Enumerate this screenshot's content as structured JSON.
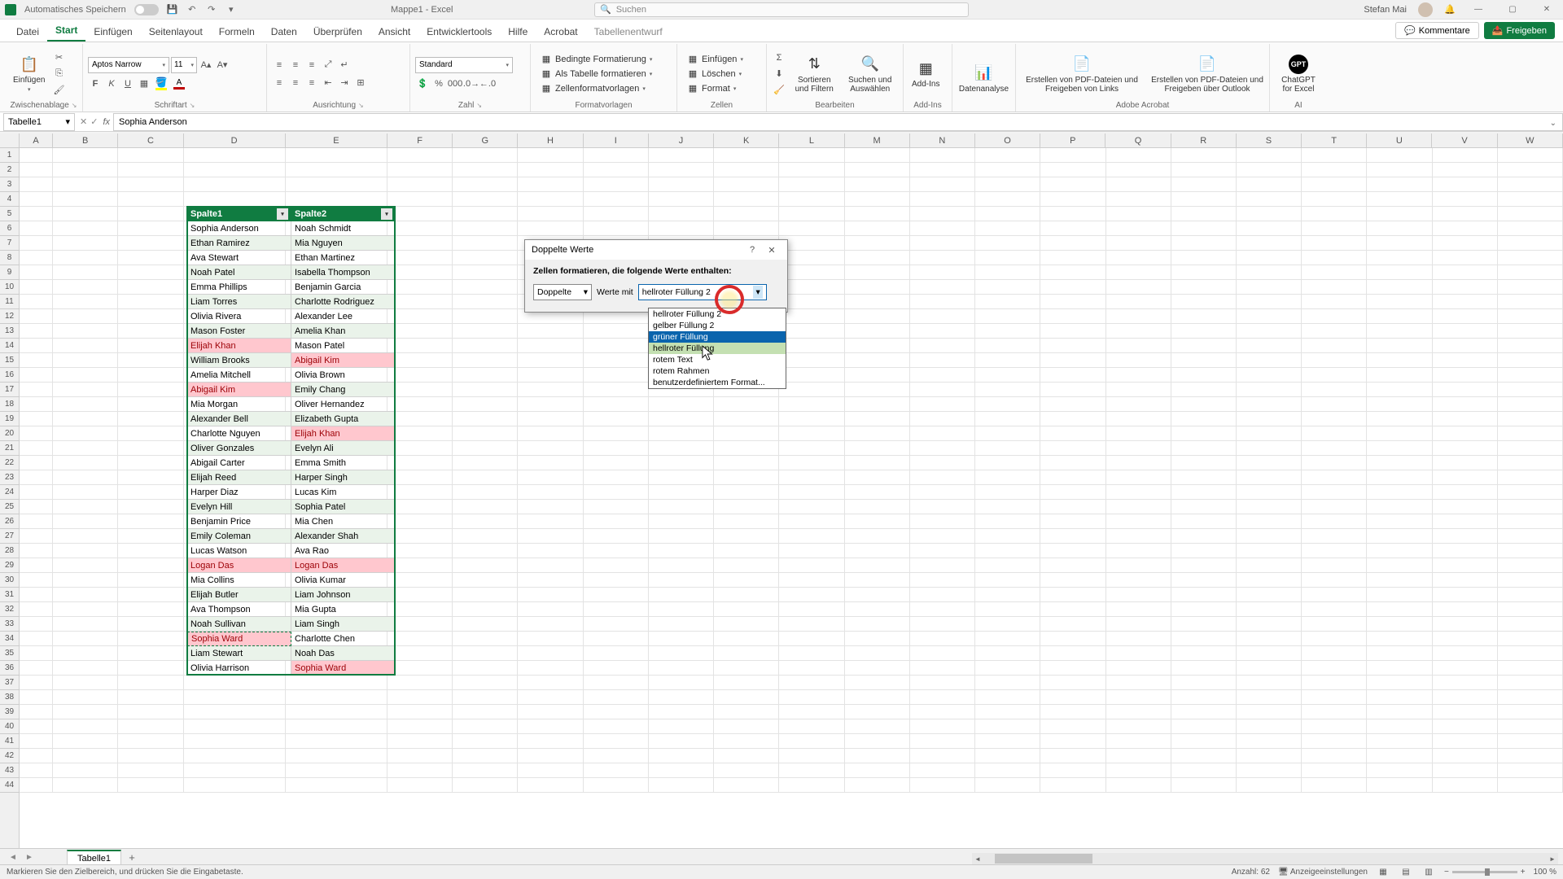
{
  "titlebar": {
    "autosave": "Automatisches Speichern",
    "doc": "Mappe1 - Excel",
    "search_placeholder": "Suchen",
    "user": "Stefan Mai"
  },
  "tabs": {
    "datei": "Datei",
    "start": "Start",
    "einfuegen": "Einfügen",
    "seitenlayout": "Seitenlayout",
    "formeln": "Formeln",
    "daten": "Daten",
    "ueberpruefen": "Überprüfen",
    "ansicht": "Ansicht",
    "entwicklertools": "Entwicklertools",
    "hilfe": "Hilfe",
    "acrobat": "Acrobat",
    "tabellenentwurf": "Tabellenentwurf",
    "kommentare": "Kommentare",
    "freigeben": "Freigeben"
  },
  "ribbon": {
    "zwischenablage": "Zwischenablage",
    "einfuegen": "Einfügen",
    "schriftart": "Schriftart",
    "font_name": "Aptos Narrow",
    "font_size": "11",
    "ausrichtung": "Ausrichtung",
    "zahl": "Zahl",
    "number_format": "Standard",
    "formatvorlagen": "Formatvorlagen",
    "bedingte": "Bedingte Formatierung",
    "als_tabelle": "Als Tabelle formatieren",
    "zellenformat": "Zellenformatvorlagen",
    "zellen": "Zellen",
    "z_einfuegen": "Einfügen",
    "z_loeschen": "Löschen",
    "z_format": "Format",
    "bearbeiten": "Bearbeiten",
    "sortieren": "Sortieren und Filtern",
    "suchen": "Suchen und Auswählen",
    "addins_label": "Add-Ins",
    "addins": "Add-Ins",
    "datenanalyse": "Datenanalyse",
    "acrobat_label": "Adobe Acrobat",
    "pdf1": "Erstellen von PDF-Dateien und Freigeben von Links",
    "pdf2": "Erstellen von PDF-Dateien und Freigeben über Outlook",
    "ai_label": "AI",
    "chatgpt": "ChatGPT for Excel"
  },
  "namebox": "Tabelle1",
  "formula": "Sophia Anderson",
  "col_letters": [
    "A",
    "B",
    "C",
    "D",
    "E",
    "F",
    "G",
    "H",
    "I",
    "J",
    "K",
    "L",
    "M",
    "N",
    "O",
    "P",
    "Q",
    "R",
    "S",
    "T",
    "U",
    "V",
    "W"
  ],
  "table": {
    "h1": "Spalte1",
    "h2": "Spalte2",
    "rows": [
      {
        "c1": "Sophia Anderson",
        "d1": false,
        "c2": "Noah Schmidt",
        "d2": false
      },
      {
        "c1": "Ethan Ramirez",
        "d1": false,
        "c2": "Mia Nguyen",
        "d2": false
      },
      {
        "c1": "Ava Stewart",
        "d1": false,
        "c2": "Ethan Martinez",
        "d2": false
      },
      {
        "c1": "Noah Patel",
        "d1": false,
        "c2": "Isabella Thompson",
        "d2": false
      },
      {
        "c1": "Emma Phillips",
        "d1": false,
        "c2": "Benjamin Garcia",
        "d2": false
      },
      {
        "c1": "Liam Torres",
        "d1": false,
        "c2": "Charlotte Rodriguez",
        "d2": false
      },
      {
        "c1": "Olivia Rivera",
        "d1": false,
        "c2": "Alexander Lee",
        "d2": false
      },
      {
        "c1": "Mason Foster",
        "d1": false,
        "c2": "Amelia Khan",
        "d2": false
      },
      {
        "c1": "Elijah Khan",
        "d1": true,
        "c2": "Mason Patel",
        "d2": false
      },
      {
        "c1": "William Brooks",
        "d1": false,
        "c2": "Abigail Kim",
        "d2": true
      },
      {
        "c1": "Amelia Mitchell",
        "d1": false,
        "c2": "Olivia Brown",
        "d2": false
      },
      {
        "c1": "Abigail Kim",
        "d1": true,
        "c2": "Emily Chang",
        "d2": false
      },
      {
        "c1": "Mia Morgan",
        "d1": false,
        "c2": "Oliver Hernandez",
        "d2": false
      },
      {
        "c1": "Alexander Bell",
        "d1": false,
        "c2": "Elizabeth Gupta",
        "d2": false
      },
      {
        "c1": "Charlotte Nguyen",
        "d1": false,
        "c2": "Elijah Khan",
        "d2": true
      },
      {
        "c1": "Oliver Gonzales",
        "d1": false,
        "c2": "Evelyn Ali",
        "d2": false
      },
      {
        "c1": "Abigail Carter",
        "d1": false,
        "c2": "Emma Smith",
        "d2": false
      },
      {
        "c1": "Elijah Reed",
        "d1": false,
        "c2": "Harper Singh",
        "d2": false
      },
      {
        "c1": "Harper Diaz",
        "d1": false,
        "c2": "Lucas Kim",
        "d2": false
      },
      {
        "c1": "Evelyn Hill",
        "d1": false,
        "c2": "Sophia Patel",
        "d2": false
      },
      {
        "c1": "Benjamin Price",
        "d1": false,
        "c2": "Mia Chen",
        "d2": false
      },
      {
        "c1": "Emily Coleman",
        "d1": false,
        "c2": "Alexander Shah",
        "d2": false
      },
      {
        "c1": "Lucas Watson",
        "d1": false,
        "c2": "Ava Rao",
        "d2": false
      },
      {
        "c1": "Logan Das",
        "d1": true,
        "c2": "Logan Das",
        "d2": true
      },
      {
        "c1": "Mia Collins",
        "d1": false,
        "c2": "Olivia Kumar",
        "d2": false
      },
      {
        "c1": "Elijah Butler",
        "d1": false,
        "c2": "Liam Johnson",
        "d2": false
      },
      {
        "c1": "Ava Thompson",
        "d1": false,
        "c2": "Mia Gupta",
        "d2": false
      },
      {
        "c1": "Noah Sullivan",
        "d1": false,
        "c2": "Liam Singh",
        "d2": false
      },
      {
        "c1": "Sophia Ward",
        "d1": true,
        "c2": "Charlotte Chen",
        "d2": false
      },
      {
        "c1": "Liam Stewart",
        "d1": false,
        "c2": "Noah Das",
        "d2": false
      },
      {
        "c1": "Olivia Harrison",
        "d1": false,
        "c2": "Sophia Ward",
        "d2": true
      }
    ]
  },
  "dialog": {
    "title": "Doppelte Werte",
    "instruction": "Zellen formatieren, die folgende Werte enthalten:",
    "type_value": "Doppelte",
    "werte_mit": "Werte mit",
    "format_value": "hellroter Füllung 2",
    "options": [
      "hellroter Füllung 2",
      "gelber Füllung 2",
      "grüner Füllung",
      "hellroter Füllung",
      "rotem Text",
      "rotem Rahmen",
      "benutzerdefiniertem Format..."
    ]
  },
  "sheet": {
    "tab1": "Tabelle1"
  },
  "status": {
    "msg": "Markieren Sie den Zielbereich, und drücken Sie die Eingabetaste.",
    "anzahl_label": "Anzahl:",
    "anzahl": "62",
    "anzeige": "Anzeigeeinstellungen",
    "zoom": "100 %"
  }
}
